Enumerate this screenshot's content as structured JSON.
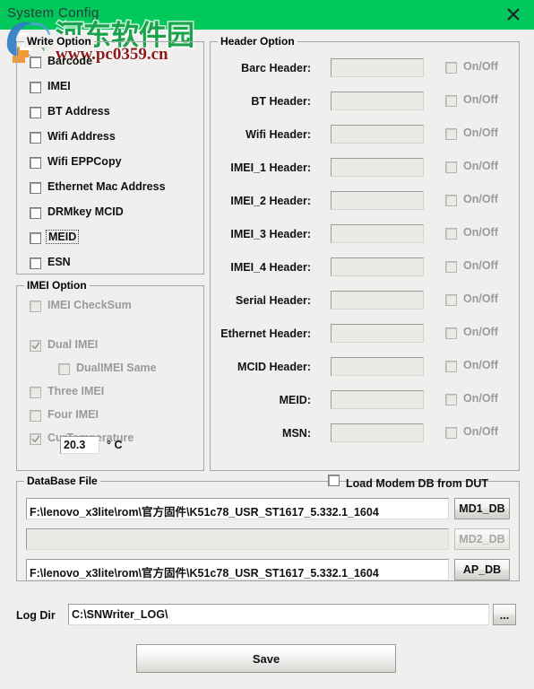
{
  "window": {
    "title": "System Config",
    "close_icon": "close-icon"
  },
  "watermark": {
    "cn_text": "河东软件园",
    "url": "www.pc0359.cn"
  },
  "write_option": {
    "legend": "Write Option",
    "items": [
      {
        "label": "Barcode",
        "checked": false,
        "enabled": true,
        "focused": false
      },
      {
        "label": "IMEI",
        "checked": false,
        "enabled": true,
        "focused": false
      },
      {
        "label": "BT Address",
        "checked": false,
        "enabled": true,
        "focused": false
      },
      {
        "label": "Wifi Address",
        "checked": false,
        "enabled": true,
        "focused": false
      },
      {
        "label": "Wifi EPPCopy",
        "checked": false,
        "enabled": true,
        "focused": false
      },
      {
        "label": "Ethernet Mac Address",
        "checked": false,
        "enabled": true,
        "focused": false
      },
      {
        "label": "DRMkey MCID",
        "checked": false,
        "enabled": true,
        "focused": false
      },
      {
        "label": "MEID",
        "checked": false,
        "enabled": true,
        "focused": true
      },
      {
        "label": "ESN",
        "checked": false,
        "enabled": true,
        "focused": false
      }
    ]
  },
  "imei_option": {
    "legend": "IMEI Option",
    "items": [
      {
        "label": "IMEI CheckSum",
        "checked": false,
        "enabled": false,
        "indent": 0
      },
      {
        "label": "Dual IMEI",
        "checked": true,
        "enabled": false,
        "indent": 0
      },
      {
        "label": "DualIMEI Same",
        "checked": false,
        "enabled": false,
        "indent": 1
      },
      {
        "label": "Three IMEI",
        "checked": false,
        "enabled": false,
        "indent": 0
      },
      {
        "label": "Four IMEI",
        "checked": false,
        "enabled": false,
        "indent": 0
      },
      {
        "label": "CurTemperature",
        "checked": true,
        "enabled": false,
        "indent": 0
      }
    ],
    "temperature_value": "20.3",
    "temperature_unit": "° C"
  },
  "header_option": {
    "legend": "Header Option",
    "onoff_label": "On/Off",
    "rows": [
      {
        "label": "Barc Header:",
        "value": "",
        "onoff": false,
        "enabled": false
      },
      {
        "label": "BT Header:",
        "value": "",
        "onoff": false,
        "enabled": false
      },
      {
        "label": "Wifi Header:",
        "value": "",
        "onoff": false,
        "enabled": false
      },
      {
        "label": "IMEI_1 Header:",
        "value": "",
        "onoff": false,
        "enabled": false
      },
      {
        "label": "IMEI_2 Header:",
        "value": "",
        "onoff": false,
        "enabled": false
      },
      {
        "label": "IMEI_3 Header:",
        "value": "",
        "onoff": false,
        "enabled": false
      },
      {
        "label": "IMEI_4 Header:",
        "value": "",
        "onoff": false,
        "enabled": false
      },
      {
        "label": "Serial Header:",
        "value": "",
        "onoff": false,
        "enabled": false
      },
      {
        "label": "Ethernet Header:",
        "value": "",
        "onoff": false,
        "enabled": false
      },
      {
        "label": "MCID Header:",
        "value": "",
        "onoff": false,
        "enabled": false
      },
      {
        "label": "MEID:",
        "value": "",
        "onoff": false,
        "enabled": false
      },
      {
        "label": "MSN:",
        "value": "",
        "onoff": false,
        "enabled": false
      }
    ]
  },
  "database_file": {
    "legend": "DataBase File",
    "load_modem_label": "Load Modem DB from DUT",
    "load_modem_checked": false,
    "rows": [
      {
        "value": "F:\\lenovo_x3lite\\rom\\官方固件\\K51c78_USR_ST1617_5.332.1_1604",
        "button": "MD1_DB",
        "enabled": true
      },
      {
        "value": "",
        "button": "MD2_DB",
        "enabled": false
      },
      {
        "value": "F:\\lenovo_x3lite\\rom\\官方固件\\K51c78_USR_ST1617_5.332.1_1604",
        "button": "AP_DB",
        "enabled": true
      }
    ]
  },
  "log_dir": {
    "label": "Log Dir",
    "value": "C:\\SNWriter_LOG\\",
    "browse_label": "..."
  },
  "save_button": {
    "label": "Save"
  },
  "colors": {
    "titlebar": "#00c85a",
    "body": "#f0efed",
    "watermark_green": "#1aa34a",
    "watermark_red": "#8c1a1a"
  }
}
